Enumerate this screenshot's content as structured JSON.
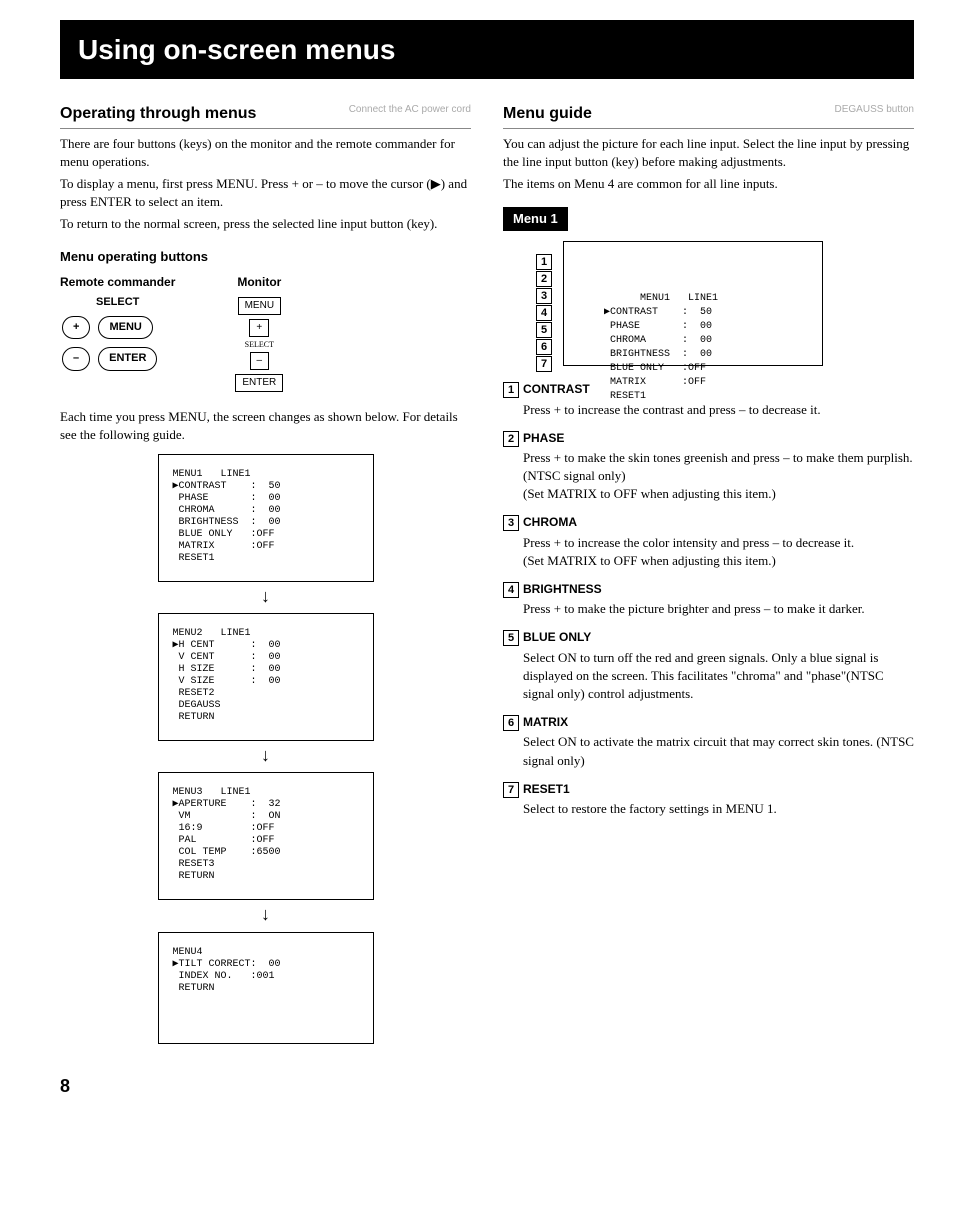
{
  "title": "Using on-screen menus",
  "page_number": "8",
  "left": {
    "section_title": "Operating through menus",
    "ghost_text": "Connect the AC power cord",
    "intro_p1": "There are four buttons (keys) on the monitor and the remote commander for menu operations.",
    "intro_p2": "To display a menu, first press MENU. Press + or – to move the cursor (▶) and press ENTER to select an item.",
    "intro_p3": "To return to the normal screen, press the selected line input button (key).",
    "subhead_buttons": "Menu operating buttons",
    "label_remote": "Remote commander",
    "label_monitor": "Monitor",
    "label_select": "SELECT",
    "btn_plus": "+",
    "btn_minus": "–",
    "btn_menu": "MENU",
    "btn_enter": "ENTER",
    "mon_menu": "MENU",
    "mon_plus": "+",
    "mon_select": "SELECT",
    "mon_minus": "–",
    "mon_enter": "ENTER",
    "between_p": "Each time you press MENU, the screen changes as shown below. For details see the following guide.",
    "menu1_text": "MENU1   LINE1\n▶CONTRAST    :  50\n PHASE       :  00\n CHROMA      :  00\n BRIGHTNESS  :  00\n BLUE ONLY   :OFF\n MATRIX      :OFF\n RESET1",
    "menu2_text": "MENU2   LINE1\n▶H CENT      :  00\n V CENT      :  00\n H SIZE      :  00\n V SIZE      :  00\n RESET2\n DEGAUSS\n RETURN",
    "menu3_text": "MENU3   LINE1\n▶APERTURE    :  32\n VM          :  ON\n 16:9        :OFF\n PAL         :OFF\n COL TEMP    :6500\n RESET3\n RETURN",
    "menu4_text": "MENU4\n▶TILT CORRECT:  00\n INDEX NO.   :001\n RETURN"
  },
  "right": {
    "section_title": "Menu guide",
    "ghost_text": "DEGAUSS button",
    "intro_p1": "You can adjust the picture for each line input. Select the line input by pressing the line input button (key) before making adjustments.",
    "intro_p2": "The items on Menu 4 are common for all line inputs.",
    "tab_label": "Menu 1",
    "diagram_text": "MENU1   LINE1\n▶CONTRAST    :  50\n PHASE       :  00\n CHROMA      :  00\n BRIGHTNESS  :  00\n BLUE ONLY   :OFF\n MATRIX      :OFF\n RESET1",
    "items": [
      {
        "n": "1",
        "term": "CONTRAST",
        "desc": "Press + to increase the contrast and press – to decrease it."
      },
      {
        "n": "2",
        "term": "PHASE",
        "desc": "Press + to make the skin tones greenish and press – to make them purplish. (NTSC signal only)\n(Set MATRIX to OFF when adjusting this item.)"
      },
      {
        "n": "3",
        "term": "CHROMA",
        "desc": "Press + to increase the color intensity and press – to decrease it.\n(Set MATRIX to OFF when adjusting this item.)"
      },
      {
        "n": "4",
        "term": "BRIGHTNESS",
        "desc": "Press + to make the picture brighter and press – to make it darker."
      },
      {
        "n": "5",
        "term": "BLUE ONLY",
        "desc": "Select ON to turn off the red and green signals. Only a blue signal is displayed on the screen. This facilitates \"chroma\" and \"phase\"(NTSC signal only) control adjustments."
      },
      {
        "n": "6",
        "term": "MATRIX",
        "desc": "Select ON to activate the matrix circuit that may correct skin tones. (NTSC signal only)"
      },
      {
        "n": "7",
        "term": "RESET1",
        "desc": "Select to restore the factory settings in MENU 1."
      }
    ]
  }
}
